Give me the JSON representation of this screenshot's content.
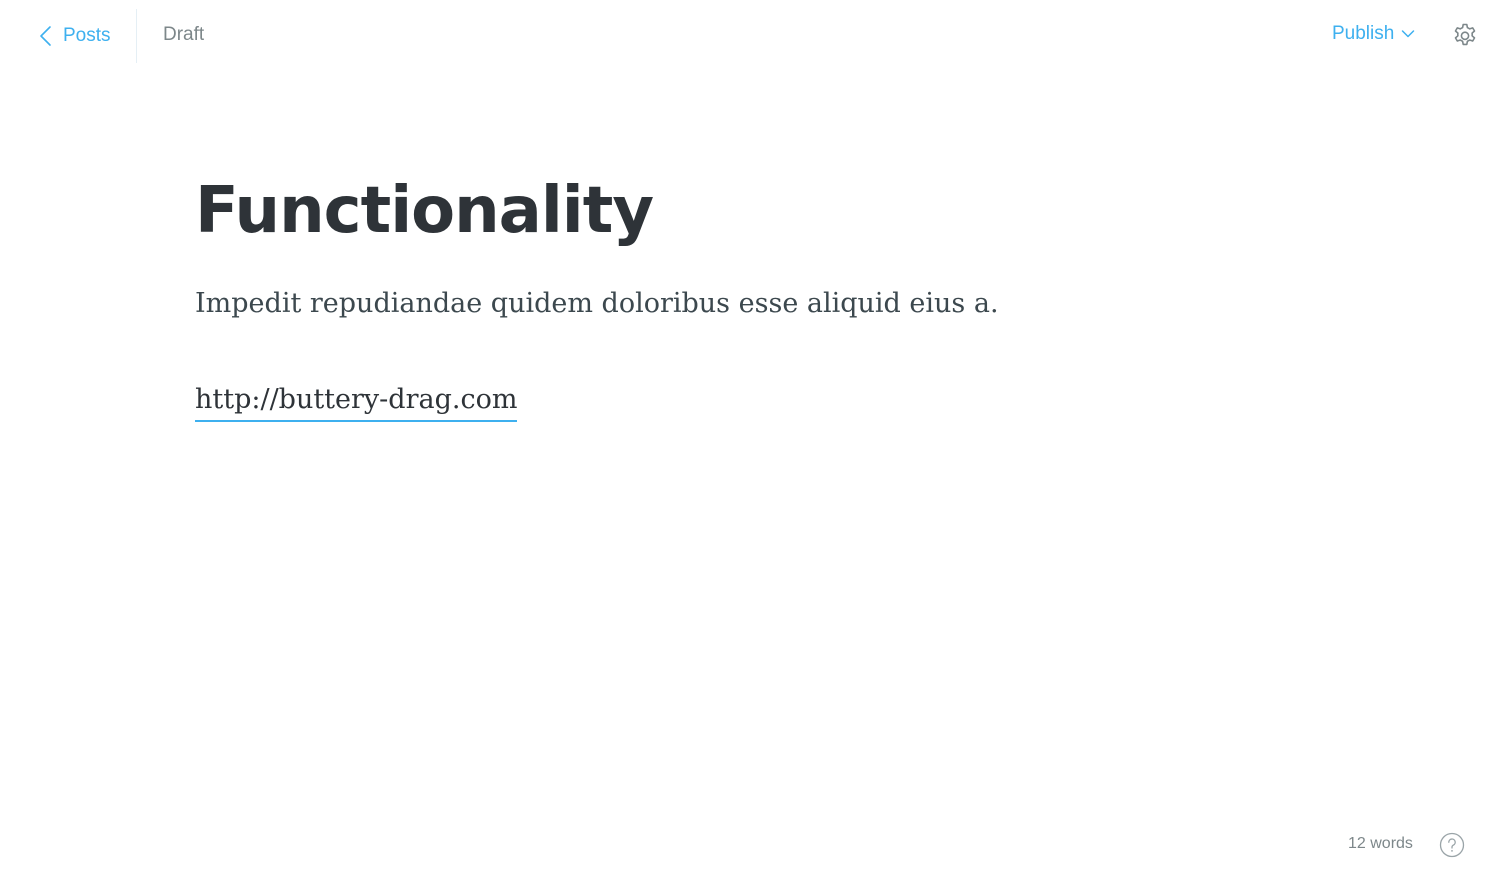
{
  "header": {
    "back_label": "Posts",
    "status": "Draft",
    "publish_label": "Publish"
  },
  "editor": {
    "title": "Functionality",
    "paragraph": "Impedit repudiandae quidem doloribus esse aliquid eius a.",
    "link_text": "http://buttery-drag.com"
  },
  "footer": {
    "word_count": "12 words"
  },
  "icons": {
    "back": "chevron-left-icon",
    "publish_caret": "chevron-down-icon",
    "settings": "gear-icon",
    "help": "question-circle-icon"
  },
  "colors": {
    "accent": "#3eb0ef",
    "text_dark": "#2e3338",
    "text_muted": "#7d878a"
  }
}
